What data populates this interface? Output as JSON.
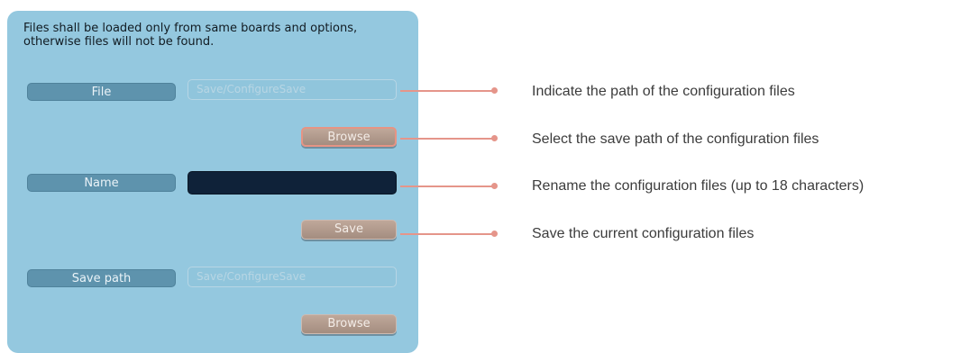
{
  "panel": {
    "notice": "Files shall be loaded only from same boards and options, otherwise files will not be found.",
    "file_row": {
      "label": "File",
      "path_value": "Save/ConfigureSave"
    },
    "browse_file_button": "Browse",
    "name_row": {
      "label": "Name",
      "value": ""
    },
    "save_button": "Save",
    "save_path_row": {
      "label": "Save path",
      "path_value": "Save/ConfigureSave"
    },
    "browse_save_path_button": "Browse"
  },
  "annotations": [
    "Indicate the path of the configuration files",
    "Select the save path of the configuration files",
    "Rename the configuration files (up to 18 characters)",
    "Save the current configuration files"
  ],
  "colors": {
    "panel_background": "#94c8df",
    "label_background": "#5e93ad",
    "name_field_background": "#0f2239",
    "button_background": "#b09a8c",
    "annotation_accent": "#e5958a"
  }
}
